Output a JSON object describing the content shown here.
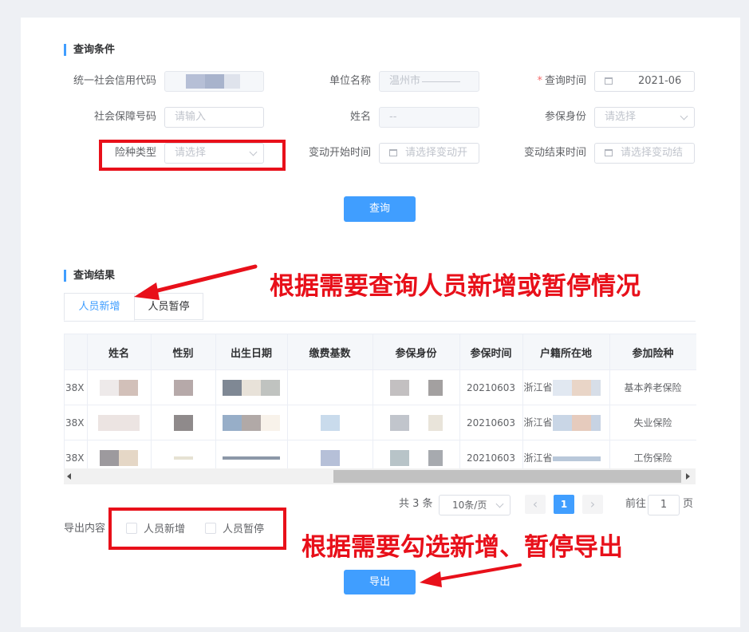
{
  "query": {
    "title": "查询条件",
    "credit_code_label": "统一社会信用代码",
    "unit_name_label": "单位名称",
    "unit_name_value": "温州市",
    "query_time_label": "查询时间",
    "query_time_value": "2021-06",
    "ss_number_label": "社会保障号码",
    "ss_number_placeholder": "请输入",
    "name_label": "姓名",
    "name_value": "--",
    "insured_identity_label": "参保身份",
    "insured_identity_placeholder": "请选择",
    "insurance_type_label": "险种类型",
    "insurance_type_placeholder": "请选择",
    "change_start_label": "变动开始时间",
    "change_start_placeholder": "请选择变动开",
    "change_end_label": "变动结束时间",
    "change_end_placeholder": "请选择变动结",
    "query_button": "查询"
  },
  "results": {
    "title": "查询结果",
    "tabs": [
      {
        "label": "人员新增"
      },
      {
        "label": "人员暂停"
      }
    ],
    "columns": [
      "姓名",
      "性别",
      "出生日期",
      "缴费基数",
      "参保身份",
      "参保时间",
      "户籍所在地",
      "参加险种"
    ],
    "rows": [
      {
        "id_suffix": "38X",
        "insured_time": "20210603",
        "residence": "浙江省",
        "insurance": "基本养老保险"
      },
      {
        "id_suffix": "38X",
        "insured_time": "20210603",
        "residence": "浙江省",
        "insurance": "失业保险"
      },
      {
        "id_suffix": "38X",
        "insured_time": "20210603",
        "residence": "浙江省",
        "insurance": "工伤保险"
      }
    ]
  },
  "pagination": {
    "total": "共 3 条",
    "page_size": "10条/页",
    "prev": "‹",
    "current": "1",
    "next": "›",
    "goto_label": "前往",
    "goto_value": "1",
    "page_suffix": "页"
  },
  "export": {
    "label": "导出内容",
    "options": [
      {
        "label": "人员新增"
      },
      {
        "label": "人员暂停"
      }
    ],
    "button": "导出"
  },
  "annotations": {
    "tip1": "根据需要查询人员新增或暂停情况",
    "tip2": "根据需要勾选新增、暂停导出"
  },
  "colors": {
    "primary": "#409eff",
    "annotation_red": "#e8101a"
  }
}
